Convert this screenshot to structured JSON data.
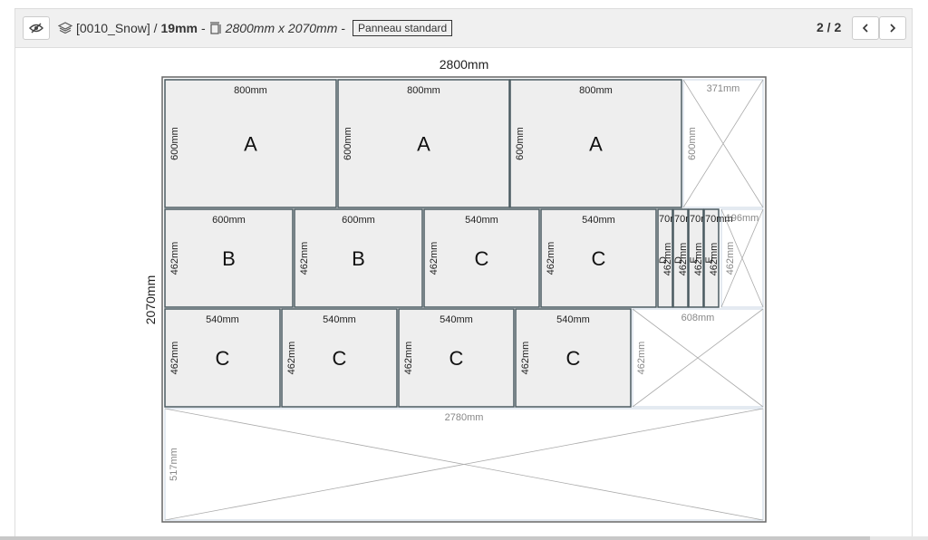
{
  "toolbar": {
    "layers_icon": "layers-icon",
    "eye_icon": "eye-off-icon",
    "material": "[0010_Snow] /",
    "thickness": "19mm",
    "sep1": "-",
    "panel_icon": "panel-icon",
    "dimensions": "2800mm x 2070mm",
    "sep2": "-",
    "panel_type": "Panneau standard",
    "pager": "2 / 2",
    "prev_icon": "chevron-left-icon",
    "next_icon": "chevron-right-icon"
  },
  "sheet": {
    "width_label": "2800mm",
    "height_label": "2070mm"
  },
  "parts": [
    {
      "letter": "A",
      "w": "800mm",
      "h": "600mm"
    },
    {
      "letter": "A",
      "w": "800mm",
      "h": "600mm"
    },
    {
      "letter": "A",
      "w": "800mm",
      "h": "600mm"
    },
    {
      "letter": "B",
      "w": "600mm",
      "h": "462mm"
    },
    {
      "letter": "B",
      "w": "600mm",
      "h": "462mm"
    },
    {
      "letter": "C",
      "w": "540mm",
      "h": "462mm"
    },
    {
      "letter": "C",
      "w": "540mm",
      "h": "462mm"
    },
    {
      "letter": "D",
      "w": "70mm",
      "h": "462mm"
    },
    {
      "letter": "D",
      "w": "70mm",
      "h": "462mm"
    },
    {
      "letter": "E",
      "w": "70mm",
      "h": "462mm"
    },
    {
      "letter": "E",
      "w": "70mm",
      "h": "462mm"
    },
    {
      "letter": "C",
      "w": "540mm",
      "h": "462mm"
    },
    {
      "letter": "C",
      "w": "540mm",
      "h": "462mm"
    },
    {
      "letter": "C",
      "w": "540mm",
      "h": "462mm"
    },
    {
      "letter": "C",
      "w": "540mm",
      "h": "462mm"
    }
  ],
  "waste": [
    {
      "w": "371mm",
      "h": "600mm"
    },
    {
      "w": "196mm",
      "h": "462mm"
    },
    {
      "w": "608mm",
      "h": "462mm"
    },
    {
      "w": "2780mm",
      "h": "517mm"
    }
  ],
  "colors": {
    "part_fill": "#eeeeee",
    "part_border": "#4a5a60",
    "sheet_border": "#666666",
    "waste_line": "#aaaaaa"
  }
}
